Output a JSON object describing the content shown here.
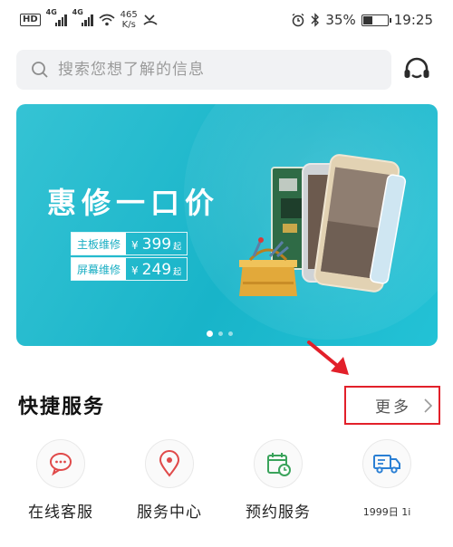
{
  "status_bar": {
    "hd": "HD",
    "net1": "4G",
    "net2": "4G",
    "speed_value": "465",
    "speed_unit": "K/s",
    "battery_percent": "35%",
    "battery_level": 0.35,
    "time": "19:25"
  },
  "search": {
    "placeholder": "搜索您想了解的信息"
  },
  "banner": {
    "title": "惠修一口价",
    "prices": [
      {
        "label": "主板维修",
        "currency": "¥",
        "amount": "399",
        "suffix": "起"
      },
      {
        "label": "屏幕维修",
        "currency": "¥",
        "amount": "249",
        "suffix": "起"
      }
    ],
    "slide_count": 3,
    "active_slide": 0
  },
  "quick_services": {
    "title": "快捷服务",
    "more_label": "更多",
    "items": [
      {
        "label": "在线客服",
        "icon": "chat-icon"
      },
      {
        "label": "服务中心",
        "icon": "location-pin-icon"
      },
      {
        "label": "预约服务",
        "icon": "calendar-clock-icon"
      },
      {
        "label": "1999日 1i",
        "icon": "delivery-truck-icon"
      }
    ]
  },
  "colors": {
    "banner": "#1fb8cc",
    "accent_red": "#e2202a",
    "icon_red": "#e04a4a",
    "icon_green": "#3aa35b",
    "icon_blue": "#2a7fd4"
  }
}
